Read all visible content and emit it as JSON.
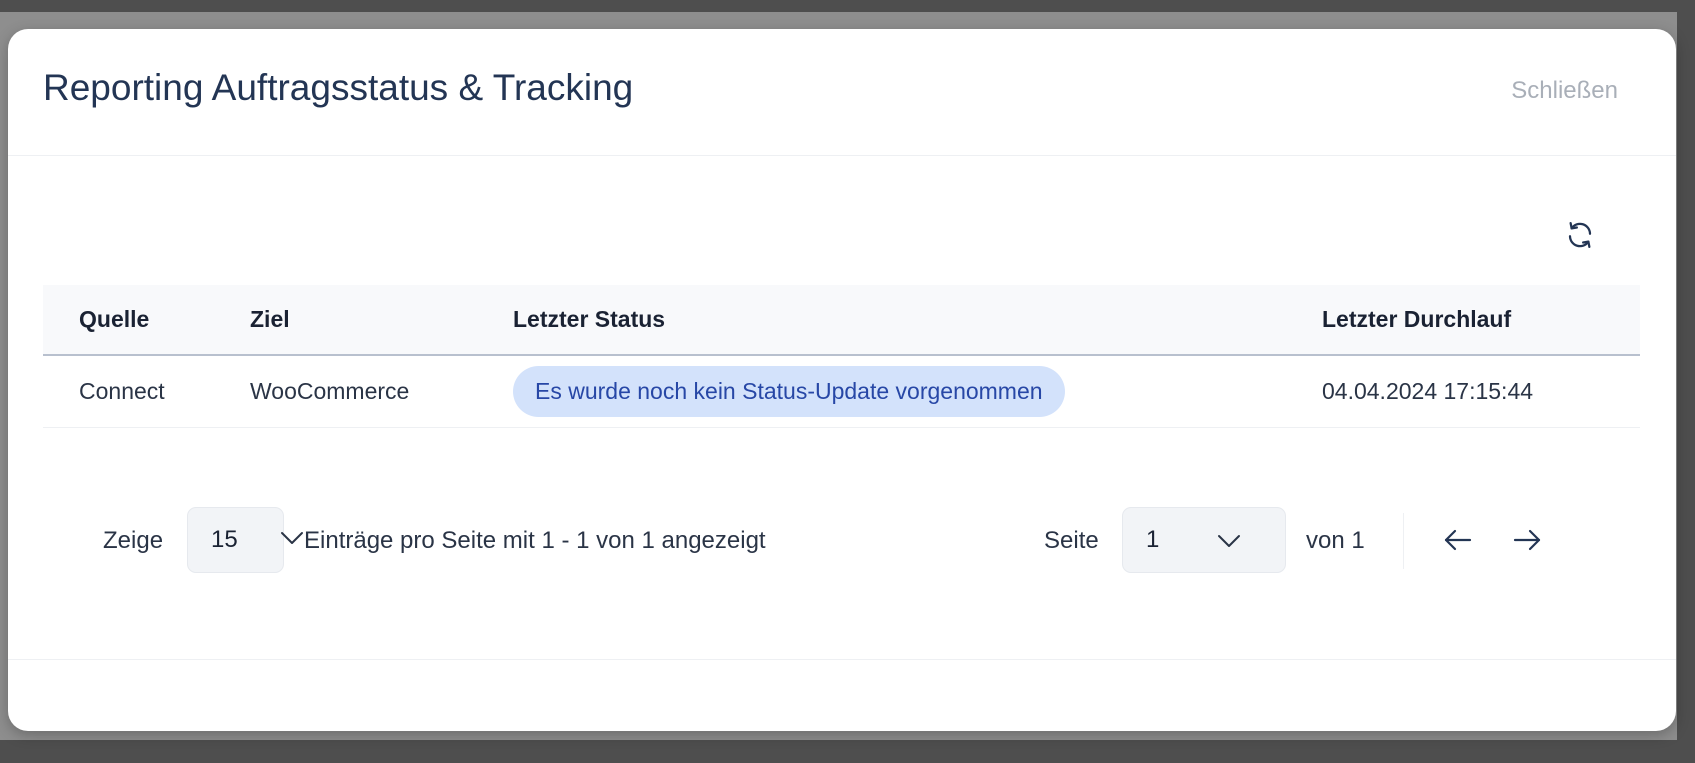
{
  "modal": {
    "title": "Reporting Auftragsstatus & Tracking",
    "close_label": "Schließen"
  },
  "table": {
    "columns": [
      "Quelle",
      "Ziel",
      "Letzter Status",
      "Letzter Durchlauf"
    ],
    "rows": [
      {
        "source": "Connect",
        "target": "WooCommerce",
        "status": "Es wurde noch kein Status-Update vorgenommen",
        "last_run": "04.04.2024 17:15:44"
      }
    ]
  },
  "pagination": {
    "show_label": "Zeige",
    "page_size": "15",
    "entries_text": "Einträge pro Seite mit 1 - 1 von 1 angezeigt",
    "page_label": "Seite",
    "current_page": "1",
    "total_text": "von 1"
  },
  "icons": {
    "refresh": "refresh-icon",
    "prev": "arrow-left-icon",
    "next": "arrow-right-icon",
    "chevron": "chevron-down-icon"
  },
  "colors": {
    "title": "#233554",
    "badge_bg": "#d3e2fb",
    "badge_text": "#2747a6",
    "close": "#a9afb8"
  }
}
